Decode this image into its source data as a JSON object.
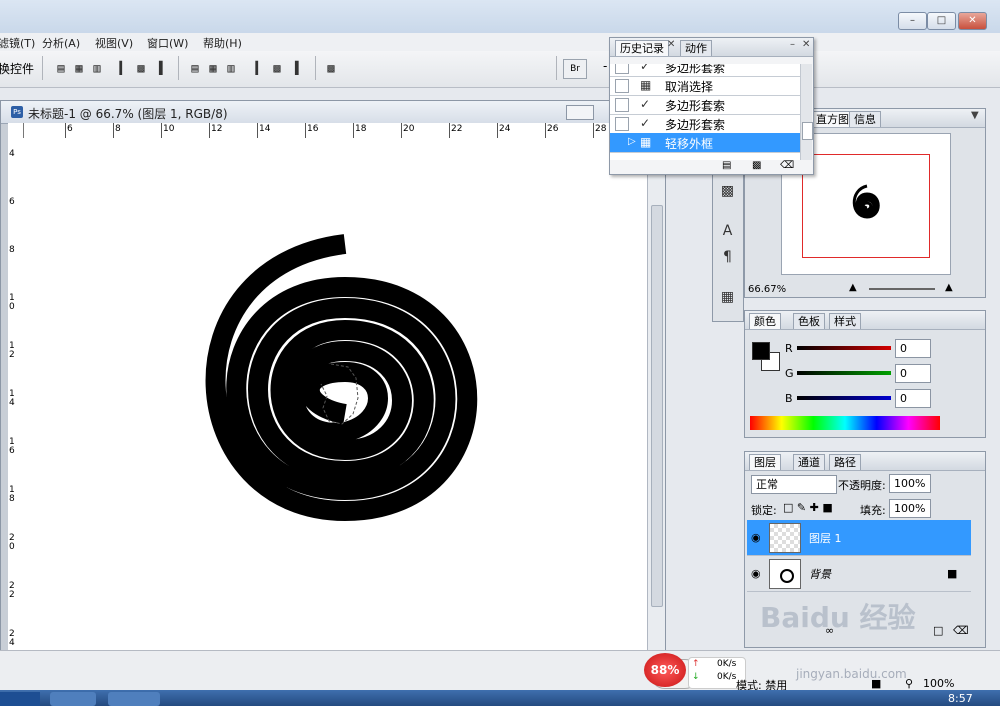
{
  "menu": {
    "items": [
      "滤镜(T)",
      "分析(A)",
      "视图(V)",
      "窗口(W)",
      "帮助(H)"
    ]
  },
  "options_bar": {
    "transform_controls_label": "换控件"
  },
  "document": {
    "title": "未标题-1 @ 66.7% (图层 1, RGB/8)",
    "h_ruler_ticks": [
      "6",
      "8",
      "10",
      "12",
      "14",
      "16",
      "18",
      "20",
      "22",
      "24",
      "26",
      "28"
    ],
    "v_ruler_ticks": [
      "4",
      "6",
      "8",
      "10",
      "12",
      "14",
      "16",
      "18",
      "20",
      "22",
      "24"
    ]
  },
  "history_panel": {
    "tabs": [
      "历史记录",
      "动作"
    ],
    "items": [
      {
        "icon": "lasso-icon",
        "label": "多边形套索"
      },
      {
        "icon": "doc-step-icon",
        "label": "取消选择"
      },
      {
        "icon": "lasso-icon",
        "label": "多边形套索"
      },
      {
        "icon": "lasso-icon",
        "label": "多边形套索"
      },
      {
        "icon": "doc-step-icon",
        "label": "轻移外框",
        "selected": true
      }
    ]
  },
  "navigator_panel": {
    "tabs": [
      "直方图",
      "信息"
    ],
    "zoom": "66.67%"
  },
  "color_panel": {
    "tabs": [
      "颜色",
      "色板",
      "样式"
    ],
    "channels": [
      {
        "label": "R",
        "value": "0",
        "color": "#d40000"
      },
      {
        "label": "G",
        "value": "0",
        "color": "#00a000"
      },
      {
        "label": "B",
        "value": "0",
        "color": "#0000d0"
      }
    ]
  },
  "layers_panel": {
    "tabs": [
      "图层",
      "通道",
      "路径"
    ],
    "blend_mode": "正常",
    "opacity_label": "不透明度:",
    "opacity_value": "100%",
    "lock_label": "锁定:",
    "fill_label": "填充:",
    "fill_value": "100%",
    "layers": [
      {
        "name": "图层 1",
        "selected": true
      },
      {
        "name": "背景",
        "locked": true
      }
    ]
  },
  "status": {
    "mode_label": "模式: 禁用",
    "zoom": "100%",
    "clock": "8:57",
    "upload_rate": "0K/s",
    "download_rate": "0K/s",
    "cpu_percent": "88%"
  },
  "watermark": {
    "text": "jingyan.baidu.com"
  },
  "colors": {
    "selection_blue": "#3399ff",
    "accent_red": "#e02a2a"
  }
}
